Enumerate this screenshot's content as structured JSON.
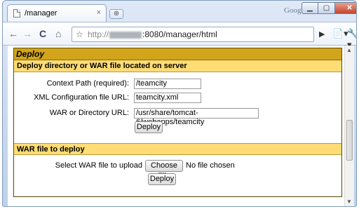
{
  "browser": {
    "tab_title": "/manager",
    "tab_close": "×",
    "new_tab": "⊕",
    "brand": "Google",
    "window_min": "▁",
    "window_max": "▢",
    "window_close": "✕",
    "nav_back": "←",
    "nav_forward": "→",
    "nav_reload": "C",
    "nav_home": "⌂",
    "star": "☆",
    "url_scheme": "http://",
    "url_rest": ":8080/manager/html",
    "tool_go": "▶",
    "tool_page": "📄▾",
    "tool_wrench": "🔧▾"
  },
  "scrollbar": {
    "up": "▲",
    "down": "▼"
  },
  "deploy": {
    "title": "Deploy",
    "dir_section_title": "Deploy directory or WAR file located on server",
    "context_path_label": "Context Path (required):",
    "context_path_value": "/teamcity",
    "xml_config_label": "XML Configuration file URL:",
    "xml_config_value": "teamcity.xml",
    "war_dir_label": "WAR or Directory URL:",
    "war_dir_value": "/usr/share/tomcat-6/webapps/teamcity",
    "deploy_button": "Deploy",
    "war_section_title": "WAR file to deploy",
    "select_war_label": "Select WAR file to upload",
    "choose_file_button": "Choose File",
    "no_file_text": "No file chosen",
    "deploy_button_2": "Deploy"
  }
}
